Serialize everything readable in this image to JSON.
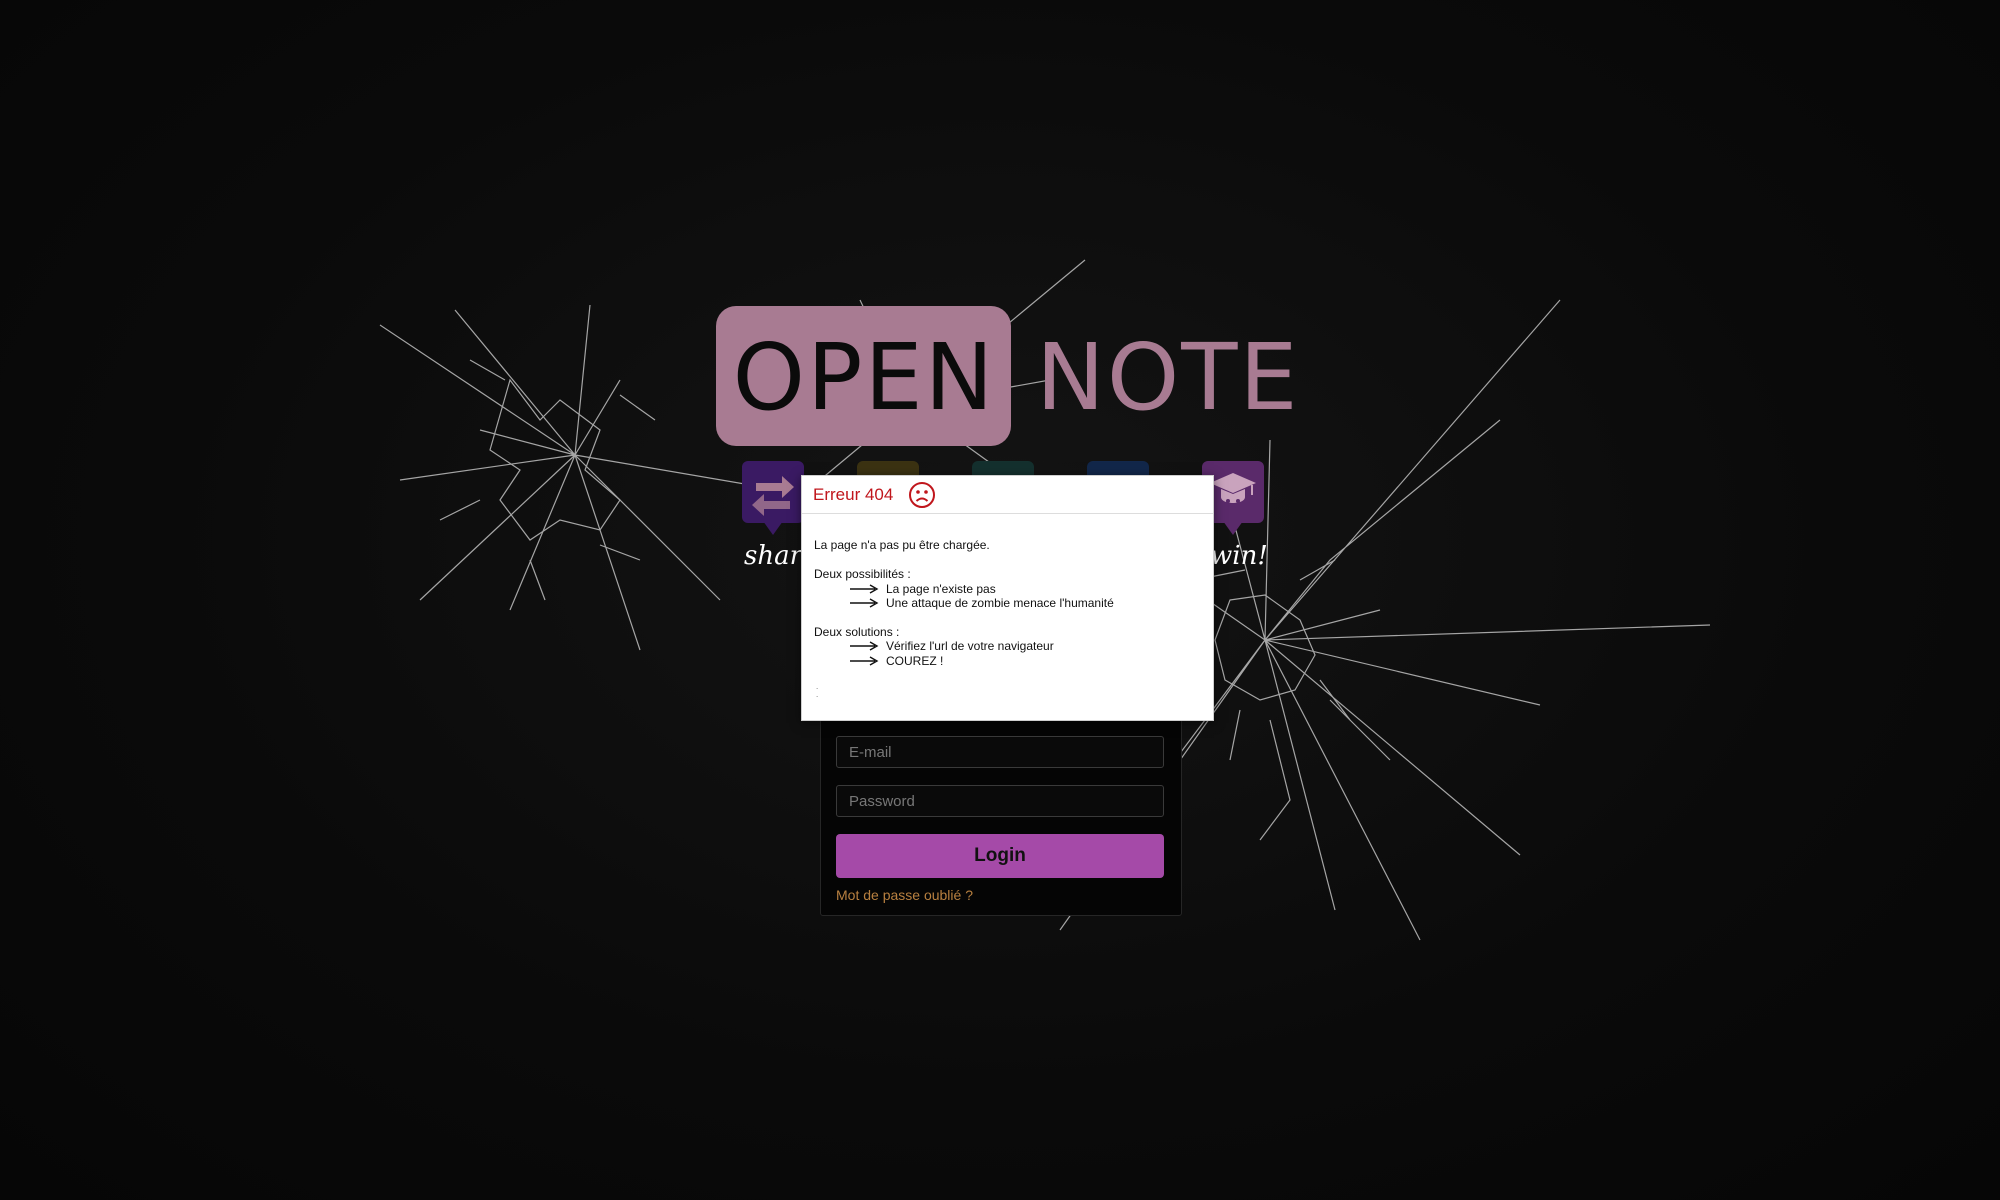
{
  "logo": {
    "open_text": "OPEN",
    "note_text": "NOTE",
    "brand_color": "#a87b92"
  },
  "features": {
    "items": [
      {
        "icon": "exchange-arrows-icon",
        "color": "#3a1a63",
        "caption": "share"
      },
      {
        "icon": "feature-icon-2",
        "color": "#3b3212",
        "caption": ""
      },
      {
        "icon": "feature-icon-3",
        "color": "#14302e",
        "caption": ""
      },
      {
        "icon": "feature-icon-4",
        "color": "#12274a",
        "caption": ""
      },
      {
        "icon": "graduation-cap-icon",
        "color": "#5a2a6a",
        "caption": "win!"
      }
    ]
  },
  "login": {
    "email_placeholder": "E-mail",
    "password_placeholder": "Password",
    "login_label": "Login",
    "forgot_label": "Mot de passe oublié ?",
    "button_color": "#a54aa8",
    "link_color": "#b88040"
  },
  "modal": {
    "title": "Erreur 404",
    "title_color": "#c0161c",
    "face_icon": "sad-face-icon",
    "intro": "La page n'a pas pu être chargée.",
    "possibilities_heading": "Deux possibilités :",
    "possibilities": [
      "La page n'existe pas",
      "Une attaque de zombie menace l'humanité"
    ],
    "solutions_heading": "Deux solutions :",
    "solutions": [
      "Vérifiez l'url de votre navigateur",
      "COUREZ !"
    ]
  }
}
